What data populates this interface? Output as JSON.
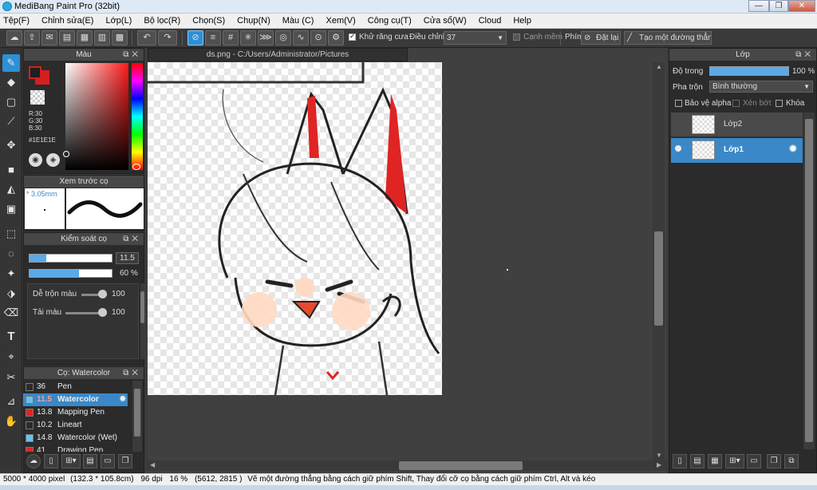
{
  "window": {
    "title": "MediBang Paint Pro (32bit)",
    "controls": {
      "minimize": "—",
      "maximize": "❐",
      "close": "✕"
    }
  },
  "menu": [
    "Tệp(F)",
    "Chỉnh sửa(E)",
    "Lớp(L)",
    "Bộ lọc(R)",
    "Chọn(S)",
    "Chụp(N)",
    "Màu (C)",
    "Xem(V)",
    "Công cụ(T)",
    "Cửa sổ(W)",
    "Cloud",
    "Help"
  ],
  "toolbar": {
    "antialias_label": "Khử răng cưa",
    "adjust_label": "Điều chỉnh",
    "adjust_value": "37",
    "smooth_label": "Cạnh mềm",
    "key_label": "Phím",
    "reset_label": "Đặt lại",
    "line_label": "Tạo một đường thẳng"
  },
  "color_panel": {
    "title": "Màu",
    "r": "R:30",
    "g": "G:30",
    "b": "B:30",
    "hex": "#1E1E1E",
    "primary": "#1e1e1e",
    "secondary": "#d42020"
  },
  "preview_panel": {
    "title": "Xem trước cọ",
    "size": "* 3.05mm"
  },
  "brush_control": {
    "title": "Kiểm soát cọ",
    "size_value": "11.5",
    "size_level": 0.2,
    "opacity_value": "60 %",
    "opacity_level": 0.6,
    "mix_label": "Dễ trộn màu",
    "mix_value": "100",
    "load_label": "Tải màu",
    "load_value": "100"
  },
  "brush_list": {
    "title": "Cọ: Watercolor",
    "items": [
      {
        "size": "36",
        "name": "Pen",
        "color": "#2b2b2b"
      },
      {
        "size": "11.5",
        "name": "Watercolor",
        "color": "#69c3ee"
      },
      {
        "size": "13.8",
        "name": "Mapping Pen",
        "color": "#e02424"
      },
      {
        "size": "10.2",
        "name": "Lineart",
        "color": "#2b2b2b"
      },
      {
        "size": "14.8",
        "name": "Watercolor (Wet)",
        "color": "#69c3ee"
      },
      {
        "size": "41",
        "name": "Drawing Pen",
        "color": "#e02424"
      }
    ]
  },
  "canvas": {
    "tab": "ds.png - C:/Users/Administrator/Pictures"
  },
  "layer_panel": {
    "title": "Lớp",
    "opacity_label": "Độ trong",
    "opacity_value": "100 %",
    "blend_label": "Pha trộn",
    "blend_value": "Bình thường",
    "protect_alpha": "Bảo vệ alpha",
    "clipping": "Xén bớt",
    "lock": "Khóa",
    "layers": [
      {
        "name": "Lớp2",
        "selected": false
      },
      {
        "name": "Lớp1",
        "selected": true
      }
    ]
  },
  "statusbar": {
    "dims": "5000 * 4000 pixel",
    "size_mm": "(132.3 * 105.8cm)",
    "dpi": "96 dpi",
    "zoom": "16 %",
    "coords": "(5612, 2815 )",
    "hint": "Vẽ một đường thẳng bằng cách giữ phím Shift, Thay đổi cỡ cọ bằng cách giữ phím Ctrl, Alt và kéo"
  }
}
